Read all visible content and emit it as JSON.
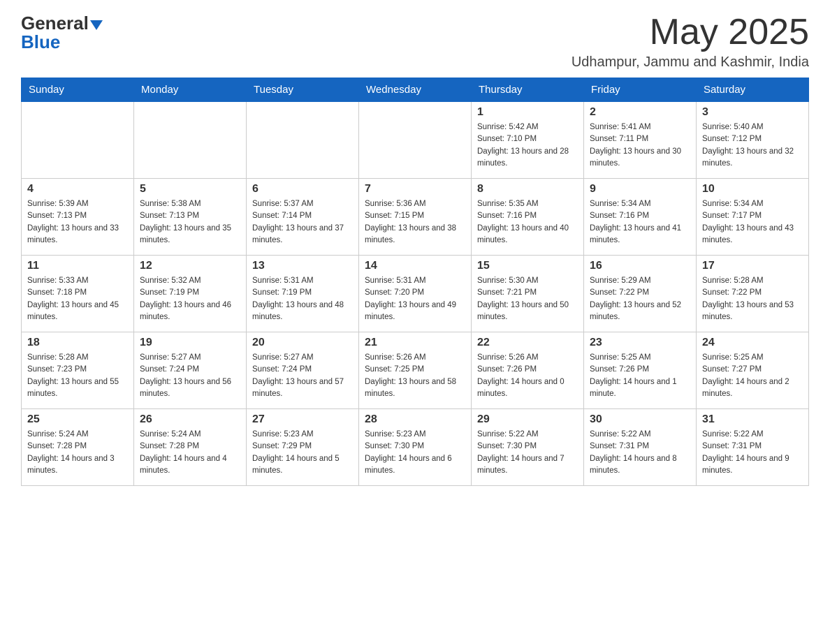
{
  "header": {
    "logo_general": "General",
    "logo_blue": "Blue",
    "month_year": "May 2025",
    "location": "Udhampur, Jammu and Kashmir, India"
  },
  "weekdays": [
    "Sunday",
    "Monday",
    "Tuesday",
    "Wednesday",
    "Thursday",
    "Friday",
    "Saturday"
  ],
  "weeks": [
    [
      {
        "day": "",
        "info": ""
      },
      {
        "day": "",
        "info": ""
      },
      {
        "day": "",
        "info": ""
      },
      {
        "day": "",
        "info": ""
      },
      {
        "day": "1",
        "info": "Sunrise: 5:42 AM\nSunset: 7:10 PM\nDaylight: 13 hours and 28 minutes."
      },
      {
        "day": "2",
        "info": "Sunrise: 5:41 AM\nSunset: 7:11 PM\nDaylight: 13 hours and 30 minutes."
      },
      {
        "day": "3",
        "info": "Sunrise: 5:40 AM\nSunset: 7:12 PM\nDaylight: 13 hours and 32 minutes."
      }
    ],
    [
      {
        "day": "4",
        "info": "Sunrise: 5:39 AM\nSunset: 7:13 PM\nDaylight: 13 hours and 33 minutes."
      },
      {
        "day": "5",
        "info": "Sunrise: 5:38 AM\nSunset: 7:13 PM\nDaylight: 13 hours and 35 minutes."
      },
      {
        "day": "6",
        "info": "Sunrise: 5:37 AM\nSunset: 7:14 PM\nDaylight: 13 hours and 37 minutes."
      },
      {
        "day": "7",
        "info": "Sunrise: 5:36 AM\nSunset: 7:15 PM\nDaylight: 13 hours and 38 minutes."
      },
      {
        "day": "8",
        "info": "Sunrise: 5:35 AM\nSunset: 7:16 PM\nDaylight: 13 hours and 40 minutes."
      },
      {
        "day": "9",
        "info": "Sunrise: 5:34 AM\nSunset: 7:16 PM\nDaylight: 13 hours and 41 minutes."
      },
      {
        "day": "10",
        "info": "Sunrise: 5:34 AM\nSunset: 7:17 PM\nDaylight: 13 hours and 43 minutes."
      }
    ],
    [
      {
        "day": "11",
        "info": "Sunrise: 5:33 AM\nSunset: 7:18 PM\nDaylight: 13 hours and 45 minutes."
      },
      {
        "day": "12",
        "info": "Sunrise: 5:32 AM\nSunset: 7:19 PM\nDaylight: 13 hours and 46 minutes."
      },
      {
        "day": "13",
        "info": "Sunrise: 5:31 AM\nSunset: 7:19 PM\nDaylight: 13 hours and 48 minutes."
      },
      {
        "day": "14",
        "info": "Sunrise: 5:31 AM\nSunset: 7:20 PM\nDaylight: 13 hours and 49 minutes."
      },
      {
        "day": "15",
        "info": "Sunrise: 5:30 AM\nSunset: 7:21 PM\nDaylight: 13 hours and 50 minutes."
      },
      {
        "day": "16",
        "info": "Sunrise: 5:29 AM\nSunset: 7:22 PM\nDaylight: 13 hours and 52 minutes."
      },
      {
        "day": "17",
        "info": "Sunrise: 5:28 AM\nSunset: 7:22 PM\nDaylight: 13 hours and 53 minutes."
      }
    ],
    [
      {
        "day": "18",
        "info": "Sunrise: 5:28 AM\nSunset: 7:23 PM\nDaylight: 13 hours and 55 minutes."
      },
      {
        "day": "19",
        "info": "Sunrise: 5:27 AM\nSunset: 7:24 PM\nDaylight: 13 hours and 56 minutes."
      },
      {
        "day": "20",
        "info": "Sunrise: 5:27 AM\nSunset: 7:24 PM\nDaylight: 13 hours and 57 minutes."
      },
      {
        "day": "21",
        "info": "Sunrise: 5:26 AM\nSunset: 7:25 PM\nDaylight: 13 hours and 58 minutes."
      },
      {
        "day": "22",
        "info": "Sunrise: 5:26 AM\nSunset: 7:26 PM\nDaylight: 14 hours and 0 minutes."
      },
      {
        "day": "23",
        "info": "Sunrise: 5:25 AM\nSunset: 7:26 PM\nDaylight: 14 hours and 1 minute."
      },
      {
        "day": "24",
        "info": "Sunrise: 5:25 AM\nSunset: 7:27 PM\nDaylight: 14 hours and 2 minutes."
      }
    ],
    [
      {
        "day": "25",
        "info": "Sunrise: 5:24 AM\nSunset: 7:28 PM\nDaylight: 14 hours and 3 minutes."
      },
      {
        "day": "26",
        "info": "Sunrise: 5:24 AM\nSunset: 7:28 PM\nDaylight: 14 hours and 4 minutes."
      },
      {
        "day": "27",
        "info": "Sunrise: 5:23 AM\nSunset: 7:29 PM\nDaylight: 14 hours and 5 minutes."
      },
      {
        "day": "28",
        "info": "Sunrise: 5:23 AM\nSunset: 7:30 PM\nDaylight: 14 hours and 6 minutes."
      },
      {
        "day": "29",
        "info": "Sunrise: 5:22 AM\nSunset: 7:30 PM\nDaylight: 14 hours and 7 minutes."
      },
      {
        "day": "30",
        "info": "Sunrise: 5:22 AM\nSunset: 7:31 PM\nDaylight: 14 hours and 8 minutes."
      },
      {
        "day": "31",
        "info": "Sunrise: 5:22 AM\nSunset: 7:31 PM\nDaylight: 14 hours and 9 minutes."
      }
    ]
  ]
}
